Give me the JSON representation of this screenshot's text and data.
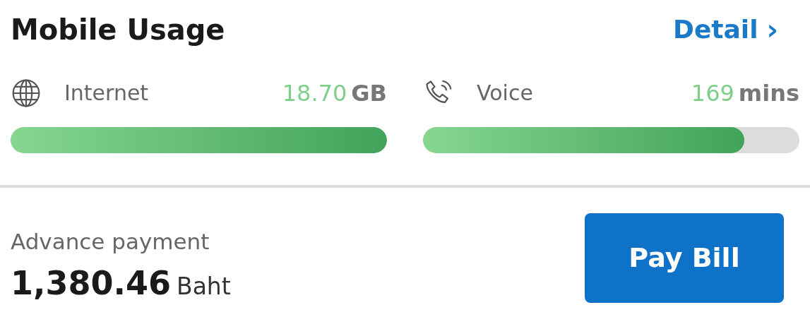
{
  "usage": {
    "title": "Mobile Usage",
    "detail_link": "Detail",
    "detail_chevron": "›",
    "meters": [
      {
        "kind": "internet",
        "label": "Internet",
        "amount": "18.70",
        "unit": "GB",
        "level": 1.0
      },
      {
        "kind": "voice",
        "label": "Voice",
        "amount": "169",
        "unit": "mins",
        "level": 0.853
      }
    ]
  },
  "payment": {
    "label": "Advance payment",
    "amount": "1,380.46",
    "currency": "Baht",
    "button": "Pay Bill"
  }
}
